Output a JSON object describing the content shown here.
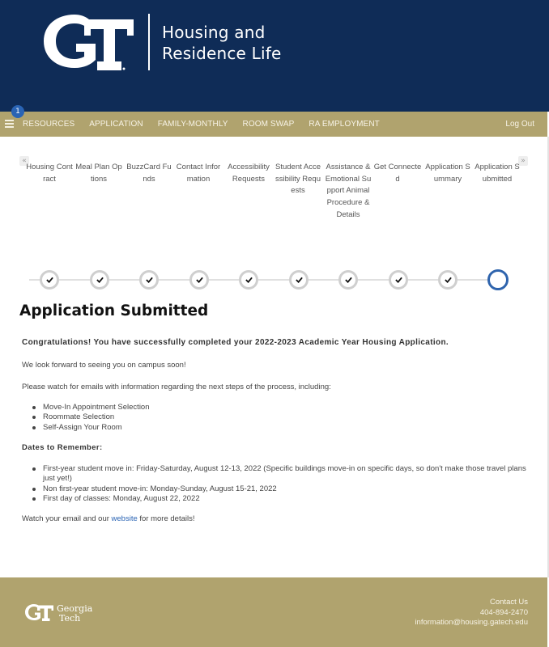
{
  "header": {
    "logo_text": "GT",
    "title_line1": "Housing and",
    "title_line2": "Residence Life"
  },
  "navbar": {
    "badge_count": "1",
    "menu_icon": "hamburger-icon",
    "items": [
      {
        "label": "RESOURCES"
      },
      {
        "label": "APPLICATION"
      },
      {
        "label": "FAMILY-MONTHLY"
      },
      {
        "label": "ROOM SWAP"
      },
      {
        "label": "RA EMPLOYMENT"
      }
    ],
    "logout_label": "Log Out"
  },
  "steps": {
    "scroll_left_icon": "«",
    "scroll_right_icon": "»",
    "items": [
      {
        "label": "Housing Contract",
        "status": "complete"
      },
      {
        "label": "Meal Plan Options",
        "status": "complete"
      },
      {
        "label": "BuzzCard Funds",
        "status": "complete"
      },
      {
        "label": "Contact Information",
        "status": "complete"
      },
      {
        "label": "Accessibility Requests",
        "status": "complete"
      },
      {
        "label": "Student Accessibility Requests",
        "status": "complete"
      },
      {
        "label": "Assistance & Emotional Support Animal Procedure & Details",
        "status": "complete"
      },
      {
        "label": "Get Connected",
        "status": "complete"
      },
      {
        "label": "Application Summary",
        "status": "complete"
      },
      {
        "label": "Application Submitted",
        "status": "current"
      }
    ],
    "accent_color": "#2f64ad"
  },
  "main": {
    "title": "Application Submitted",
    "congrats": "Congratulations! You have successfully completed your 2022-2023 Academic Year Housing Application.",
    "look_forward": "We look forward to seeing you on campus soon!",
    "watch_emails": "Please watch for emails with information regarding the next steps of the process, including:",
    "next_steps": [
      "Move-In Appointment Selection",
      "Roommate Selection",
      "Self-Assign Your Room"
    ],
    "dates_heading": "Dates to Remember:",
    "dates": [
      "First-year student move in: Friday-Saturday, August 12-13, 2022 (Specific buildings move-in on specific days, so don't make those travel plans just yet!)",
      "Non first-year student move-in: Monday-Sunday, August 15-21, 2022",
      "First day of classes: Monday, August 22, 2022"
    ],
    "closing_before": "Watch your email and our ",
    "closing_link": "website",
    "closing_after": " for more details!"
  },
  "footer": {
    "logo_line1": "Georgia",
    "logo_line2": "Tech",
    "contact_label": "Contact Us",
    "phone": "404-894-2470",
    "email": "information@housing.gatech.edu"
  },
  "colors": {
    "navy": "#0f2c57",
    "gold": "#b0a36e",
    "link": "#2a64b4"
  }
}
